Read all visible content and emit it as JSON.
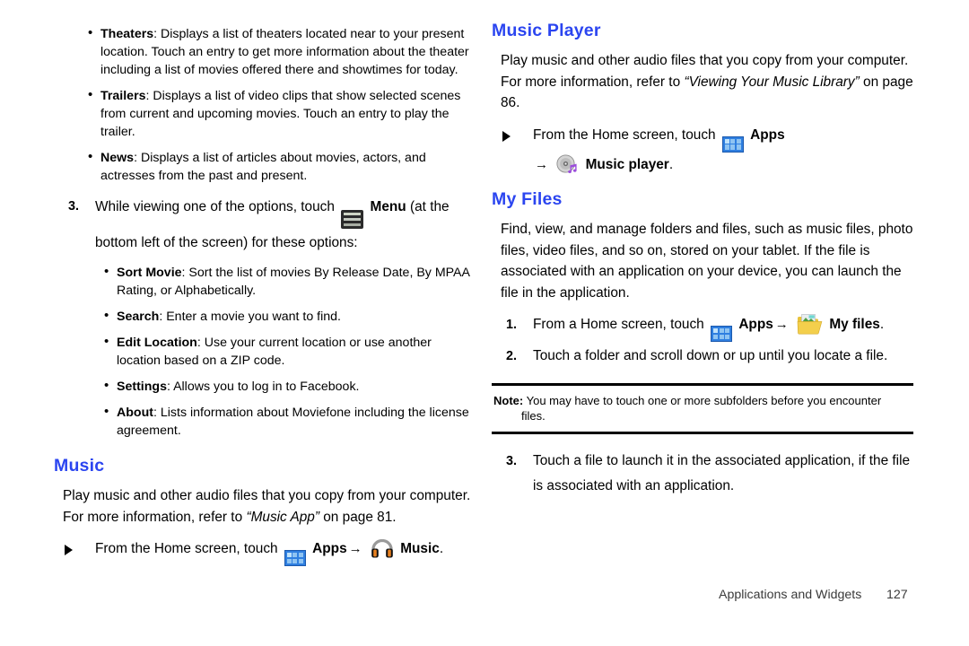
{
  "page": {
    "footer_text": "Applications and Widgets",
    "footer_page_number": "127",
    "heading_color": "#2b45f0"
  },
  "left_column": {
    "moviefone_bullets": [
      {
        "term": "Theaters",
        "text": ": Displays a list of theaters located near to your present location. Touch an entry to get more information about the theater including a list of movies offered there and showtimes for today."
      },
      {
        "term": "Trailers",
        "text": ": Displays a list of video clips that show selected scenes from current and upcoming movies. Touch an entry to play the trailer."
      },
      {
        "term": "News",
        "text": ": Displays a list of articles about movies, actors, and actresses from the past and present."
      }
    ],
    "step3": {
      "number": "3.",
      "text_before_icon": "While viewing one of the options, touch",
      "menu_icon": "menu-icon",
      "menu_label": "Menu",
      "text_after_icon": "(at the bottom left of the screen) for these options:"
    },
    "menu_option_bullets": [
      {
        "term": "Sort Movie",
        "text": ": Sort the list of movies By Release Date, By MPAA Rating, or Alphabetically."
      },
      {
        "term": "Search",
        "text": ": Enter a movie you want to find."
      },
      {
        "term": "Edit Location",
        "text": ": Use your current location or use another location based on a ZIP code."
      },
      {
        "term": "Settings",
        "text": ": Allows you to log in to Facebook."
      },
      {
        "term": "About",
        "text": ": Lists information about Moviefone including the license agreement."
      }
    ],
    "music_section": {
      "heading": "Music",
      "body_part1": "Play music and other audio files that you copy from your computer. For more information, refer to ",
      "body_italic": "“Music App”",
      "body_part2": " on page 81.",
      "step": {
        "text_before_apps": "From the Home screen, touch",
        "apps_icon": "apps-grid-icon",
        "apps_label": "Apps",
        "arrow": "→",
        "music_icon": "headphones-icon",
        "music_label": "Music",
        "period": "."
      }
    }
  },
  "right_column": {
    "music_player_section": {
      "heading": "Music Player",
      "body_part1": "Play music and other audio files that you copy from your computer. For more information, refer to ",
      "body_italic": "“Viewing Your Music Library”",
      "body_part2": " on page 86.",
      "step": {
        "text_before_apps": "From the Home screen, touch",
        "apps_icon": "apps-grid-icon",
        "apps_label": "Apps",
        "arrow": "→",
        "player_icon": "cd-music-note-icon",
        "player_label": "Music player",
        "period": "."
      }
    },
    "my_files_section": {
      "heading": "My Files",
      "body": "Find, view, and manage folders and files, such as music files, photo files, video files, and so on, stored on your tablet. If the file is associated with an application on your device, you can launch the file in the application.",
      "step1": {
        "number": "1.",
        "text_before_apps": "From a Home screen, touch",
        "apps_icon": "apps-grid-icon",
        "apps_label": "Apps",
        "arrow": "→",
        "folder_icon": "folder-icon",
        "files_label": "My files",
        "period": "."
      },
      "step2": {
        "number": "2.",
        "text": "Touch a folder and scroll down or up until you locate a file."
      },
      "note": {
        "label": "Note:",
        "text": "You may have to touch one or more subfolders before you encounter",
        "text_line2": "files."
      },
      "step3": {
        "number": "3.",
        "text": "Touch a file to launch it in the associated application, if the file is associated with an application."
      }
    }
  }
}
